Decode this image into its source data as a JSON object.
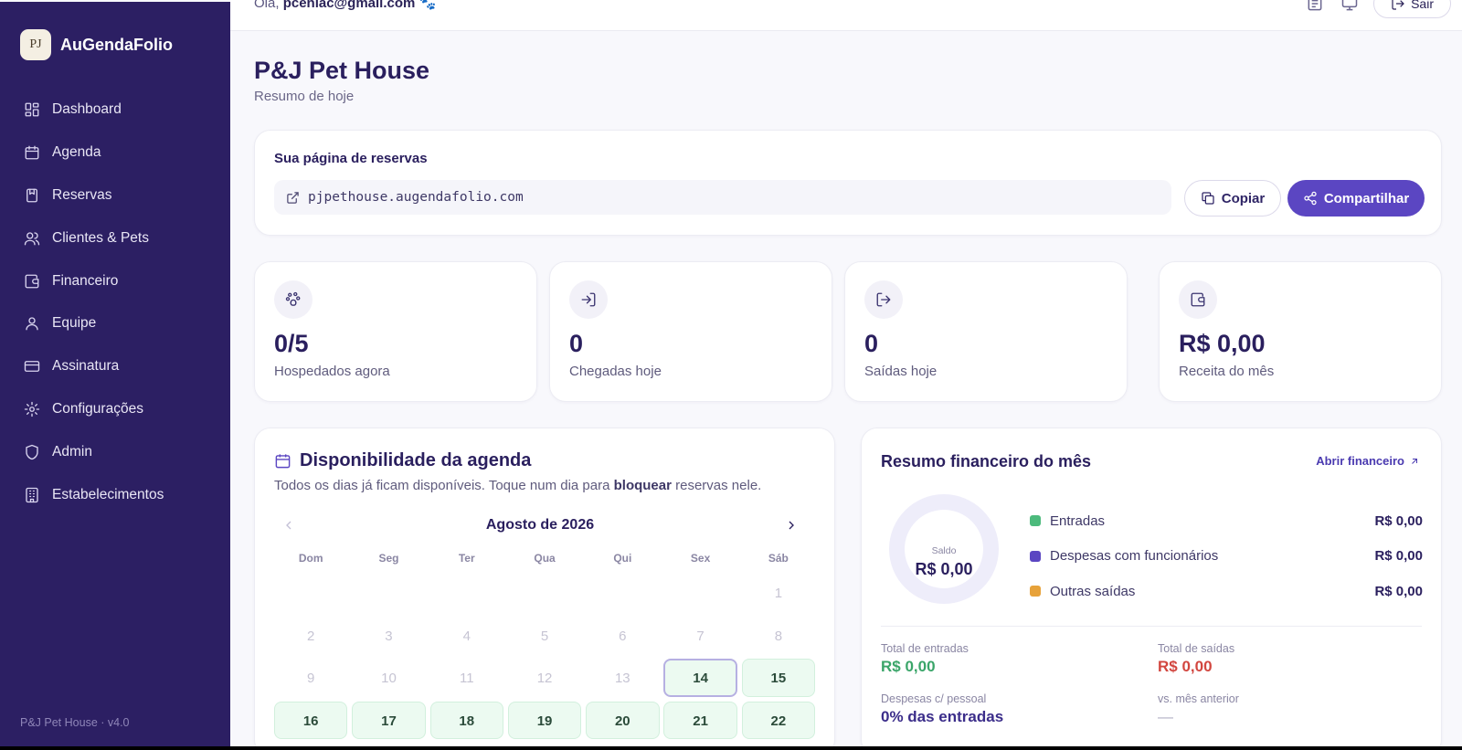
{
  "brand": {
    "logo_text": "PJ",
    "name": "AuGendaFolio"
  },
  "sidebar": {
    "items": [
      {
        "label": "Dashboard",
        "icon": "dashboard-icon"
      },
      {
        "label": "Agenda",
        "icon": "calendar-icon"
      },
      {
        "label": "Reservas",
        "icon": "bookmark-icon"
      },
      {
        "label": "Clientes & Pets",
        "icon": "users-icon"
      },
      {
        "label": "Financeiro",
        "icon": "wallet-icon"
      },
      {
        "label": "Equipe",
        "icon": "user-icon"
      },
      {
        "label": "Assinatura",
        "icon": "credit-card-icon"
      },
      {
        "label": "Configurações",
        "icon": "gear-icon"
      },
      {
        "label": "Admin",
        "icon": "shield-icon"
      },
      {
        "label": "Estabelecimentos",
        "icon": "building-icon"
      }
    ],
    "footer": "P&J Pet House · v4.0"
  },
  "topbar": {
    "greeting_prefix": "Olá,",
    "email": "pcenlac@gmail.com",
    "logout_label": "Sair"
  },
  "page": {
    "title": "P&J Pet House",
    "subtitle": "Resumo de hoje"
  },
  "booking": {
    "title": "Sua página de reservas",
    "url": "pjpethouse.augendafolio.com",
    "copy_label": "Copiar",
    "share_label": "Compartilhar"
  },
  "stats": [
    {
      "value": "0/5",
      "label": "Hospedados agora",
      "icon": "paw-icon"
    },
    {
      "value": "0",
      "label": "Chegadas hoje",
      "icon": "login-icon"
    },
    {
      "value": "0",
      "label": "Saídas hoje",
      "icon": "logout-icon"
    },
    {
      "value": "R$ 0,00",
      "label": "Receita do mês",
      "icon": "wallet-icon"
    }
  ],
  "calendar": {
    "title": "Disponibilidade da agenda",
    "desc_before": "Todos os dias já ficam disponíveis. Toque num dia para ",
    "desc_bold": "bloquear",
    "desc_after": " reservas nele.",
    "month": "Agosto de 2026",
    "weekdays": [
      "Dom",
      "Seg",
      "Ter",
      "Qua",
      "Qui",
      "Sex",
      "Sáb"
    ],
    "leading_blanks": 6,
    "days": [
      1,
      2,
      3,
      4,
      5,
      6,
      7,
      8,
      9,
      10,
      11,
      12,
      13,
      14,
      15,
      16,
      17,
      18,
      19,
      20,
      21,
      22
    ],
    "today": 14,
    "available_from": 14
  },
  "finance": {
    "title": "Resumo financeiro do mês",
    "link_label": "Abrir financeiro",
    "donut_label": "Saldo",
    "donut_value": "R$ 0,00",
    "legend": [
      {
        "name": "Entradas",
        "value": "R$ 0,00",
        "color": "#4cba7c"
      },
      {
        "name": "Despesas com funcionários",
        "value": "R$ 0,00",
        "color": "#5b46c2"
      },
      {
        "name": "Outras saídas",
        "value": "R$ 0,00",
        "color": "#e7a23a"
      }
    ],
    "total_in_label": "Total de entradas",
    "total_in_value": "R$ 0,00",
    "total_out_label": "Total de saídas",
    "total_out_value": "R$ 0,00",
    "staff_label": "Despesas c/ pessoal",
    "staff_value": "0% das entradas",
    "prev_label": "vs. mês anterior",
    "prev_value": "—"
  }
}
